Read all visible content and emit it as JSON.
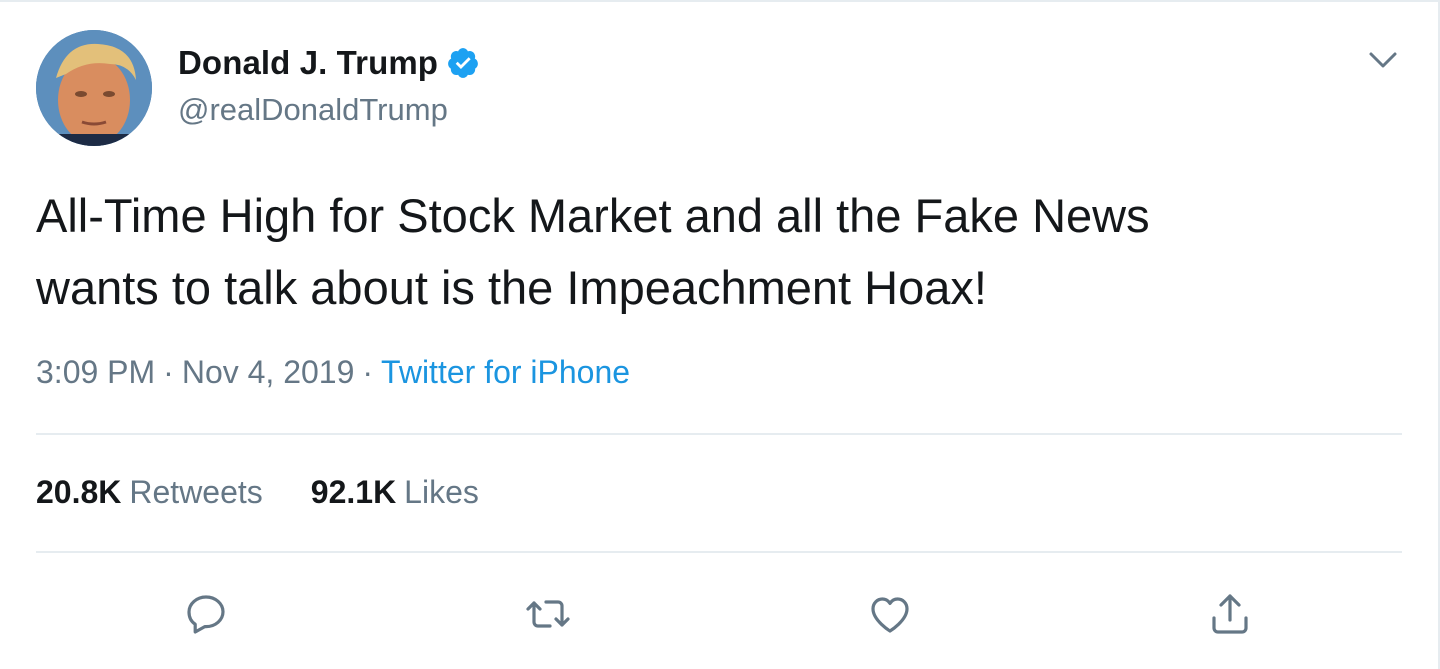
{
  "author": {
    "display_name": "Donald J. Trump",
    "handle": "@realDonaldTrump",
    "verified": true,
    "avatar_icon": "profile-photo"
  },
  "tweet": {
    "text": "All-Time High for Stock Market and all the Fake News\nwants to talk about is the Impeachment Hoax!",
    "time": "3:09 PM",
    "date": "Nov 4, 2019",
    "separator": "·",
    "source": "Twitter for iPhone"
  },
  "stats": {
    "retweets_count": "20.8K",
    "retweets_label": "Retweets",
    "likes_count": "92.1K",
    "likes_label": "Likes"
  },
  "actions": {
    "reply_icon": "reply-icon",
    "retweet_icon": "retweet-icon",
    "like_icon": "heart-icon",
    "share_icon": "share-icon"
  },
  "colors": {
    "text_primary": "#14171a",
    "text_secondary": "#657786",
    "link": "#1b95e0",
    "verified": "#1da1f2",
    "divider": "#e6ecf0"
  }
}
